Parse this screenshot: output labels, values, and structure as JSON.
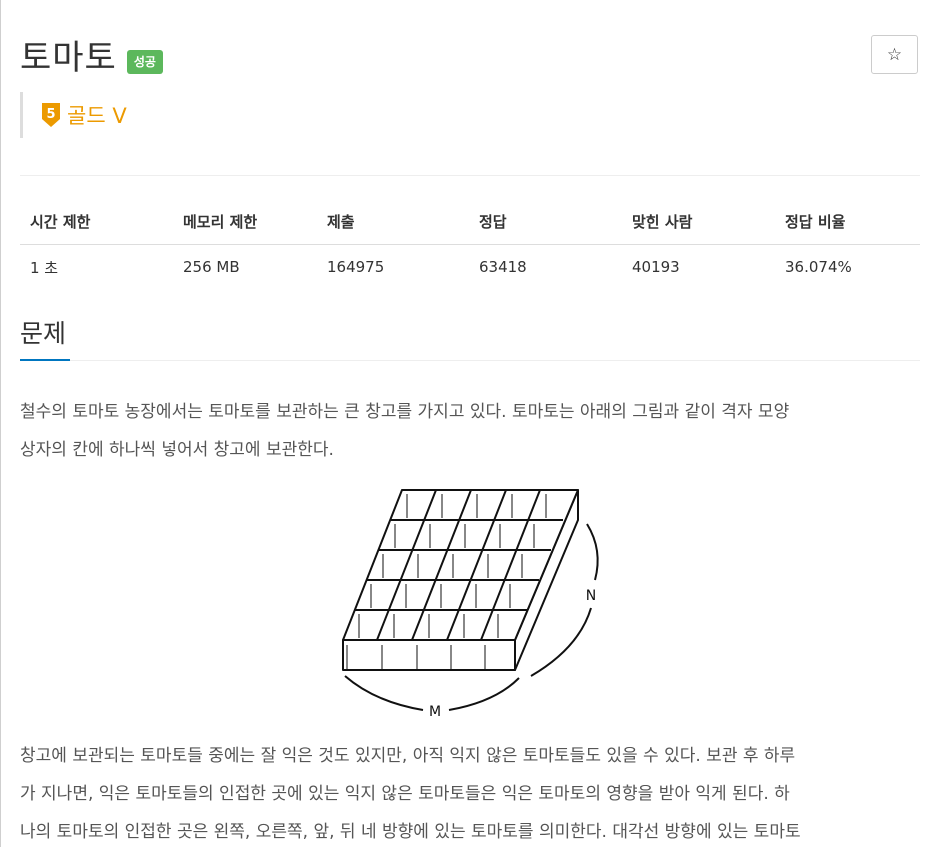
{
  "problem": {
    "title": "토마토",
    "status_badge": "성공",
    "star_glyph": "☆",
    "tier": {
      "number": "5",
      "label": "골드 V",
      "color": "#ec9a00"
    }
  },
  "info_table": {
    "headers": [
      "시간 제한",
      "메모리 제한",
      "제출",
      "정답",
      "맞힌 사람",
      "정답 비율"
    ],
    "row": [
      "1 초",
      "256 MB",
      "164975",
      "63418",
      "40193",
      "36.074%"
    ]
  },
  "section": {
    "title": "문제",
    "paragraph1": [
      "철수의 토마토 농장에서는 토마토를 보관하는 큰 창고를 가지고 있다. 토마토는 아래의 그림과 같이 격자 모양",
      "상자의 칸에 하나씩 넣어서 창고에 보관한다."
    ],
    "figure": {
      "label_n": "N",
      "label_m": "M"
    },
    "paragraph2": [
      "창고에 보관되는 토마토들 중에는 잘 익은 것도 있지만, 아직 익지 않은 토마토들도 있을 수 있다. 보관 후 하루",
      "가 지나면, 익은 토마토들의 인접한 곳에 있는 익지 않은 토마토들은 익은 토마토의 영향을 받아 익게 된다. 하",
      "나의 토마토의 인접한 곳은 왼쪽, 오른쪽, 앞, 뒤 네 방향에 있는 토마토를 의미한다. 대각선 방향에 있는 토마토"
    ]
  },
  "colors": {
    "success": "#5cb85c",
    "accent": "#0076c0",
    "tier": "#ec9a00"
  }
}
